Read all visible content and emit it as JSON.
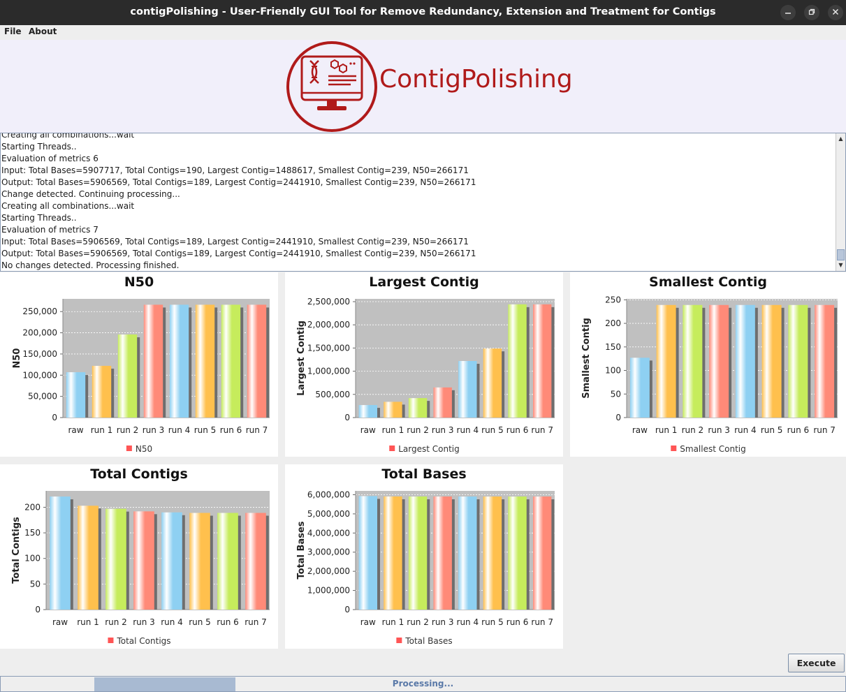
{
  "window": {
    "title": "contigPolishing - User-Friendly GUI Tool for Remove Redundancy, Extension and Treatment for Contigs"
  },
  "menu": {
    "file": "File",
    "about": "About"
  },
  "banner": {
    "logo_text": "ContigPolishing",
    "logo_icon": "dna-monitor-icon",
    "brand_color": "#b01a1a"
  },
  "log": {
    "lines": [
      "Creating all combinations...wait",
      "Starting Threads..",
      "Evaluation of metrics 6",
      "Input: Total Bases=5907717, Total Contigs=190, Largest Contig=1488617, Smallest Contig=239, N50=266171",
      "Output: Total Bases=5906569, Total Contigs=189, Largest Contig=2441910, Smallest Contig=239, N50=266171",
      "Change detected. Continuing processing...",
      "Creating all combinations...wait",
      "Starting Threads..",
      "Evaluation of metrics 7",
      "Input: Total Bases=5906569, Total Contigs=189, Largest Contig=2441910, Smallest Contig=239, N50=266171",
      "Output: Total Bases=5906569, Total Contigs=189, Largest Contig=2441910, Smallest Contig=239, N50=266171",
      "No changes detected. Processing finished."
    ]
  },
  "chart_data": [
    {
      "type": "bar",
      "title": "N50",
      "ylabel": "N50",
      "legend": "N50",
      "categories": [
        "raw",
        "run 1",
        "run 2",
        "run 3",
        "run 4",
        "run 5",
        "run 6",
        "run 7"
      ],
      "values": [
        107000,
        122000,
        196000,
        266171,
        266171,
        266171,
        266171,
        266171
      ],
      "yticks": [
        "0",
        "50,000",
        "100,000",
        "150,000",
        "200,000",
        "250,000"
      ],
      "ylim": [
        0,
        280000
      ],
      "tickvals": [
        0,
        50000,
        100000,
        150000,
        200000,
        250000
      ]
    },
    {
      "type": "bar",
      "title": "Largest Contig",
      "ylabel": "Largest Contig",
      "legend": "Largest Contig",
      "categories": [
        "raw",
        "run 1",
        "run 2",
        "run 3",
        "run 4",
        "run 5",
        "run 6",
        "run 7"
      ],
      "values": [
        270000,
        340000,
        420000,
        650000,
        1220000,
        1488617,
        2441910,
        2441910
      ],
      "yticks": [
        "0",
        "500,000",
        "1,000,000",
        "1,500,000",
        "2,000,000",
        "2,500,000"
      ],
      "ylim": [
        0,
        2560000
      ],
      "tickvals": [
        0,
        500000,
        1000000,
        1500000,
        2000000,
        2500000
      ]
    },
    {
      "type": "bar",
      "title": "Smallest Contig",
      "ylabel": "Smallest Contig",
      "legend": "Smallest Contig",
      "categories": [
        "raw",
        "run 1",
        "run 2",
        "run 3",
        "run 4",
        "run 5",
        "run 6",
        "run 7"
      ],
      "values": [
        127,
        239,
        239,
        239,
        239,
        239,
        239,
        239
      ],
      "yticks": [
        "0",
        "50",
        "100",
        "150",
        "200",
        "250"
      ],
      "ylim": [
        0,
        252
      ],
      "tickvals": [
        0,
        50,
        100,
        150,
        200,
        250
      ]
    },
    {
      "type": "bar",
      "title": "Total Contigs",
      "ylabel": "Total Contigs",
      "legend": "Total Contigs",
      "categories": [
        "raw",
        "run 1",
        "run 2",
        "run 3",
        "run 4",
        "run 5",
        "run 6",
        "run 7"
      ],
      "values": [
        221,
        203,
        197,
        192,
        190,
        189,
        189,
        189
      ],
      "yticks": [
        "0",
        "50",
        "100",
        "150",
        "200"
      ],
      "ylim": [
        0,
        232
      ],
      "tickvals": [
        0,
        50,
        100,
        150,
        200
      ]
    },
    {
      "type": "bar",
      "title": "Total Bases",
      "ylabel": "Total Bases",
      "legend": "Total Bases",
      "categories": [
        "raw",
        "run 1",
        "run 2",
        "run 3",
        "run 4",
        "run 5",
        "run 6",
        "run 7"
      ],
      "values": [
        5930000,
        5910000,
        5908000,
        5907717,
        5907000,
        5906569,
        5906569,
        5906569
      ],
      "yticks": [
        "0",
        "1,000,000",
        "2,000,000",
        "3,000,000",
        "4,000,000",
        "5,000,000",
        "6,000,000"
      ],
      "ylim": [
        0,
        6200000
      ],
      "tickvals": [
        0,
        1000000,
        2000000,
        3000000,
        4000000,
        5000000,
        6000000
      ]
    }
  ],
  "chart_style": {
    "plot_background": "#c0c0c0",
    "legend_marker_color": "#ff5555",
    "bar_colors": [
      "#8ed0f2",
      "#ffc04d",
      "#c6ec5c",
      "#ff8a78",
      "#8ed0f2",
      "#ffc04d",
      "#c6ec5c",
      "#ff8a78"
    ]
  },
  "actions": {
    "execute_label": "Execute"
  },
  "status": {
    "progress_text": "Processing..."
  }
}
